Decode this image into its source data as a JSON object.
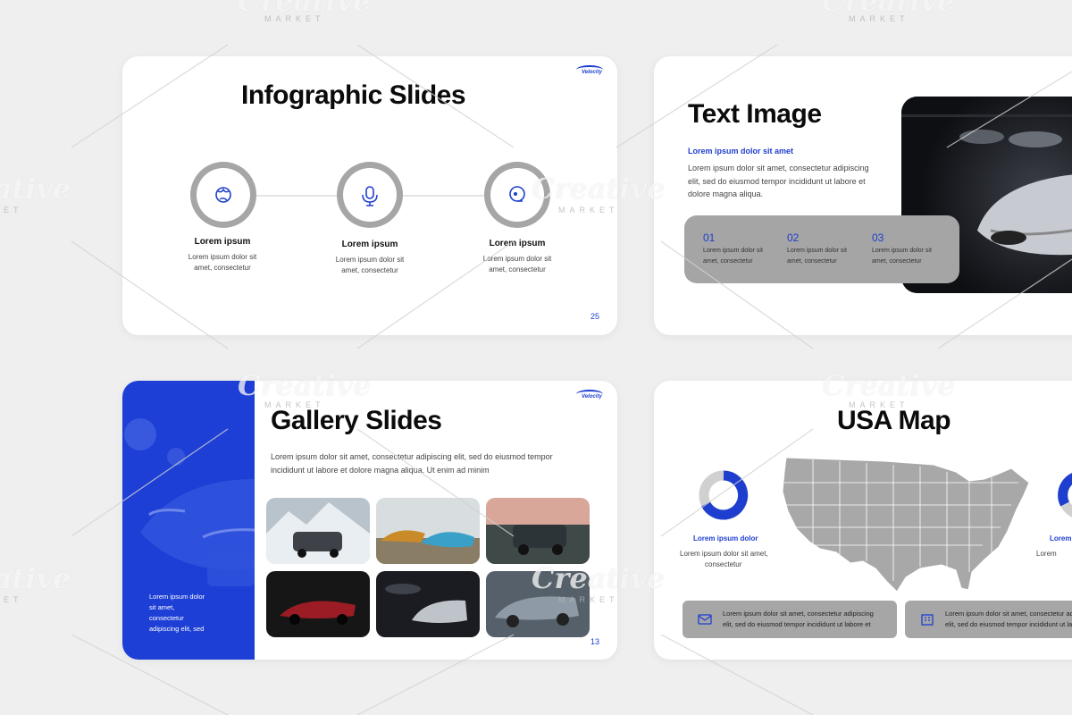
{
  "watermark": {
    "brand": "Creative",
    "sub": "MARKET"
  },
  "logo_text": "Velocity",
  "slide_infographic": {
    "title": "Infographic Slides",
    "page": "25",
    "items": [
      {
        "icon": "globe-icon",
        "heading": "Lorem ipsum",
        "text1": "Lorem ipsum dolor sit",
        "text2": "amet, consectetur"
      },
      {
        "icon": "microphone-icon",
        "heading": "Lorem ipsum",
        "text1": "Lorem ipsum dolor sit",
        "text2": "amet, consectetur"
      },
      {
        "icon": "headset-icon",
        "heading": "Lorem ipsum",
        "text1": "Lorem ipsum dolor sit",
        "text2": "amet, consectetur"
      }
    ]
  },
  "slide_text_image": {
    "title": "Text Image",
    "subtitle": "Lorem ipsum dolor sit amet",
    "body1": "Lorem ipsum dolor sit amet, consectetur adipiscing",
    "body2": "elit, sed do eiusmod tempor incididunt ut labore et",
    "body3": "dolore magna aliqua.",
    "items": [
      {
        "num": "01",
        "text1": "Lorem ipsum dolor sit",
        "text2": "amet, consectetur"
      },
      {
        "num": "02",
        "text1": "Lorem ipsum dolor sit",
        "text2": "amet, consectetur"
      },
      {
        "num": "03",
        "text1": "Lorem ipsum dolor sit",
        "text2": "amet, consectetur"
      }
    ]
  },
  "slide_gallery": {
    "title": "Gallery Slides",
    "body1": "Lorem ipsum dolor sit amet, consectetur adipiscing elit, sed do eiusmod tempor",
    "body2": "incididunt ut labore et dolore magna aliqua. Ut enim ad minim",
    "side1": "Lorem ipsum dolor",
    "side2": "sit amet,",
    "side3": "consectetur",
    "side4": "adipiscing elit, sed",
    "page": "13"
  },
  "slide_map": {
    "title": "USA Map",
    "left_stat": {
      "label": "Lorem ipsum dolor",
      "text1": "Lorem ipsum dolor sit amet,",
      "text2": "consectetur"
    },
    "right_stat": {
      "label": "Lorem",
      "text1": "Lorem"
    },
    "box1": {
      "icon": "mail-icon",
      "text1": "Lorem ipsum dolor sit amet, consectetur adipiscing",
      "text2": "elit, sed do eiusmod tempor incididunt ut labore et"
    },
    "box2": {
      "icon": "building-icon",
      "text1": "Lorem ipsum dolor sit amet, consectetur adipiscing",
      "text2": "elit, sed do eiusmod tempor incididunt ut labore et"
    }
  }
}
